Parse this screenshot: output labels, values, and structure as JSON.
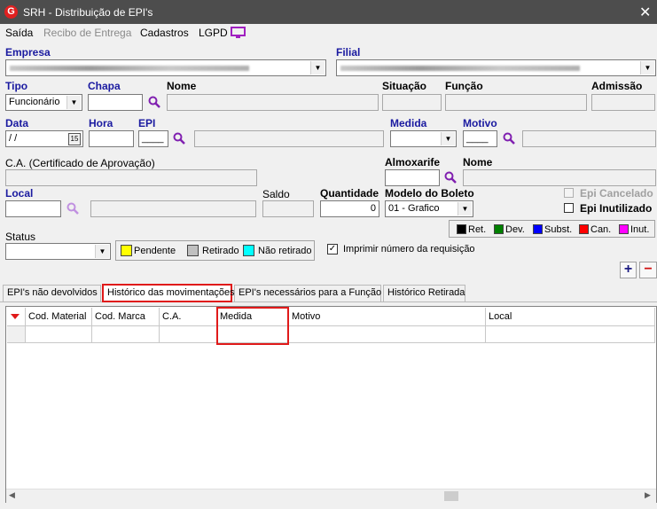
{
  "window": {
    "title": "SRH - Distribuição de EPI's",
    "app_icon": "G"
  },
  "menu": [
    "Saída",
    "Recibo de Entrega",
    "Cadastros",
    "LGPD"
  ],
  "fields": {
    "empresa": "Empresa",
    "filial": "Filial",
    "tipo": "Tipo",
    "tipo_value": "Funcionário",
    "chapa": "Chapa",
    "nome": "Nome",
    "situacao": "Situação",
    "funcao": "Função",
    "admissao": "Admissão",
    "data": "Data",
    "data_value": " / /",
    "hora": "Hora",
    "epi": "EPI",
    "epi_value": "____",
    "medida": "Medida",
    "motivo": "Motivo",
    "motivo_value": "____",
    "ca": "C.A. (Certificado de Aprovação)",
    "almoxarife": "Almoxarife",
    "nome2": "Nome",
    "local": "Local",
    "saldo": "Saldo",
    "quantidade": "Quantidade",
    "quantidade_value": "0",
    "modelo_boleto": "Modelo do Boleto",
    "modelo_value": "01 - Grafico",
    "epi_cancelado": "Epi Cancelado",
    "epi_inutilizado": "Epi Inutilizado",
    "status": "Status",
    "imprimir": "Imprimir número da requisição"
  },
  "status_legend": [
    {
      "label": "Pendente",
      "color": "#ffff00"
    },
    {
      "label": "Retirado",
      "color": "#c0c0c0"
    },
    {
      "label": "Não retirado",
      "color": "#00ffff"
    }
  ],
  "color_legend": [
    {
      "label": "Ret.",
      "color": "#000000"
    },
    {
      "label": "Dev.",
      "color": "#008000"
    },
    {
      "label": "Subst.",
      "color": "#0000ff"
    },
    {
      "label": "Can.",
      "color": "#ff0000"
    },
    {
      "label": "Inut.",
      "color": "#ff00ff"
    }
  ],
  "tabs": [
    "EPI's não devolvidos",
    "Histórico das movimentações",
    "EPI's necessários para a Função",
    "Histórico Retirada"
  ],
  "grid": {
    "columns": [
      "Cod. Material",
      "Cod. Marca",
      "C.A.",
      "Medida",
      "Motivo",
      "Local"
    ]
  },
  "buttons": {
    "add": "+",
    "remove": "−"
  },
  "icons": {
    "date_picker": "15"
  }
}
